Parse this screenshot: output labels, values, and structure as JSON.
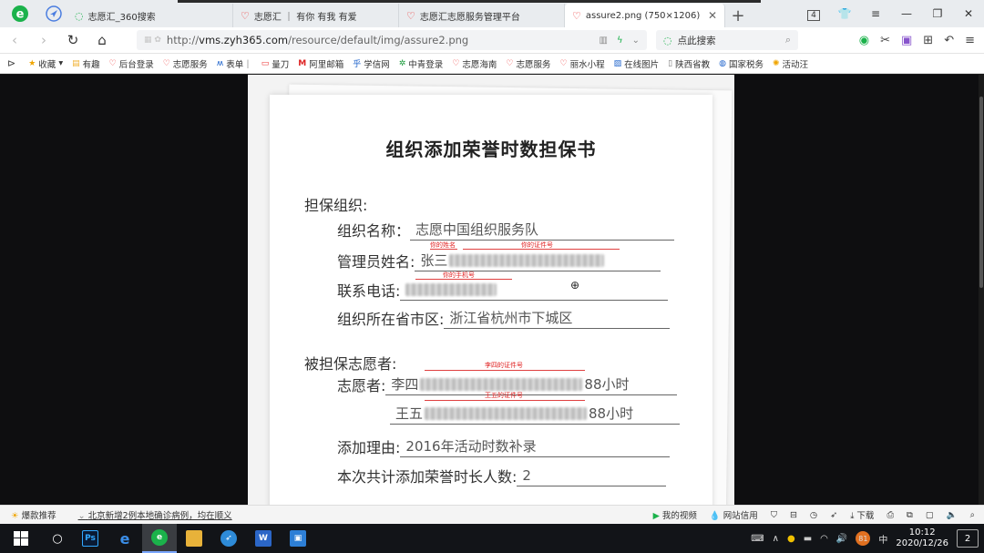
{
  "tabs": [
    {
      "title": "志愿汇_360搜索",
      "icon": "search-icon"
    },
    {
      "title": "志愿汇 ｜ 有你 有我 有爱",
      "icon": "heart-icon"
    },
    {
      "title": "志愿汇志愿服务管理平台",
      "icon": "heart-icon"
    },
    {
      "title": "assure2.png (750×1206)",
      "icon": "heart-icon",
      "active": true
    }
  ],
  "window": {
    "badge": "4"
  },
  "address": {
    "url_prefix": "http://",
    "url_domain": "vms.zyh365.com",
    "url_path": "/resource/default/img/assure2.png",
    "search_placeholder": "点此搜索"
  },
  "bookmarks": [
    "收藏",
    "有趣",
    "后台登录",
    "志愿服务",
    "表单｜",
    "量刀",
    "阿里邮箱",
    "学信网",
    "中青登录",
    "志愿海南",
    "志愿服务",
    "丽水小程",
    "在线图片",
    "陕西省教",
    "国家税务",
    "活动汪"
  ],
  "document": {
    "title": "组织添加荣誉时数担保书",
    "guarantor_header": "担保组织:",
    "org_name_label": "组织名称：",
    "org_name_value": "志愿中国组织服务队",
    "admin_label": "管理员姓名:",
    "admin_name": "张三",
    "phone_label": "联系电话:",
    "region_label": "组织所在省市区:",
    "region_value": "浙江省杭州市下城区",
    "guaranteed_header": "被担保志愿者:",
    "volunteer_label": "志愿者:",
    "volunteer1_name": "李四",
    "volunteer1_hours": "88小时",
    "volunteer2_name": "王五",
    "volunteer2_hours": "88小时",
    "reason_label": "添加理由:",
    "reason_value": "2016年活动时数补录",
    "count_label": "本次共计添加荣誉时长人数:",
    "count_value": "2",
    "annotations": {
      "your_name": "你的姓名",
      "your_id": "你的证件号",
      "your_phone": "你的手机号",
      "lisi_id": "李四的证件号",
      "wangwu_id": "王五的证件号"
    }
  },
  "statusbar": {
    "hot": "爆款推荐",
    "news": "北京新增2例本地确诊病例，均在顺义",
    "video": "我的视频",
    "bank": "网站信用",
    "download": "下载"
  },
  "taskbar": {
    "time": "10:12",
    "date": "2020/12/26",
    "notifications": "2",
    "tray_badge": "81"
  }
}
